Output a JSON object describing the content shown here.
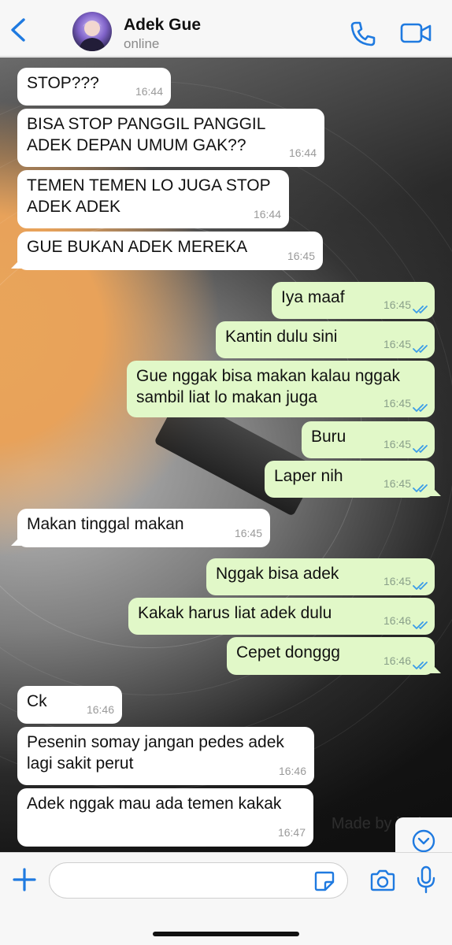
{
  "header": {
    "contact_name": "Adek Gue",
    "status": "online",
    "accent": "#1f7ae0"
  },
  "watermark": "Made by iFake",
  "messages": [
    {
      "dir": "in",
      "text": "STOP???",
      "time": "16:44"
    },
    {
      "dir": "in",
      "text": "BISA STOP PANGGIL PANGGIL\nADEK DEPAN UMUM GAK??",
      "time": "16:44"
    },
    {
      "dir": "in",
      "text": "TEMEN TEMEN LO JUGA STOP\nADEK ADEK",
      "time": "16:44"
    },
    {
      "dir": "in",
      "text": "GUE BUKAN ADEK MEREKA",
      "time": "16:45"
    },
    {
      "dir": "out",
      "text": "Iya maaf",
      "time": "16:45"
    },
    {
      "dir": "out",
      "text": "Kantin dulu sini",
      "time": "16:45"
    },
    {
      "dir": "out",
      "text": "Gue nggak bisa makan kalau nggak\nsambil liat lo makan juga",
      "time": "16:45"
    },
    {
      "dir": "out",
      "text": "Buru",
      "time": "16:45"
    },
    {
      "dir": "out",
      "text": "Laper nih",
      "time": "16:45"
    },
    {
      "dir": "in",
      "text": "Makan tinggal makan",
      "time": "16:45"
    },
    {
      "dir": "out",
      "text": "Nggak bisa adek",
      "time": "16:45"
    },
    {
      "dir": "out",
      "text": "Kakak harus liat adek dulu",
      "time": "16:46"
    },
    {
      "dir": "out",
      "text": "Cepet donggg",
      "time": "16:46"
    },
    {
      "dir": "in",
      "text": "Ck",
      "time": "16:46"
    },
    {
      "dir": "in",
      "text": "Pesenin somay jangan pedes adek\nlagi sakit perut",
      "time": "16:46"
    },
    {
      "dir": "in",
      "text": "Adek nggak mau ada temen kakak",
      "time": "16:47"
    }
  ],
  "input": {
    "placeholder": "",
    "value": ""
  }
}
